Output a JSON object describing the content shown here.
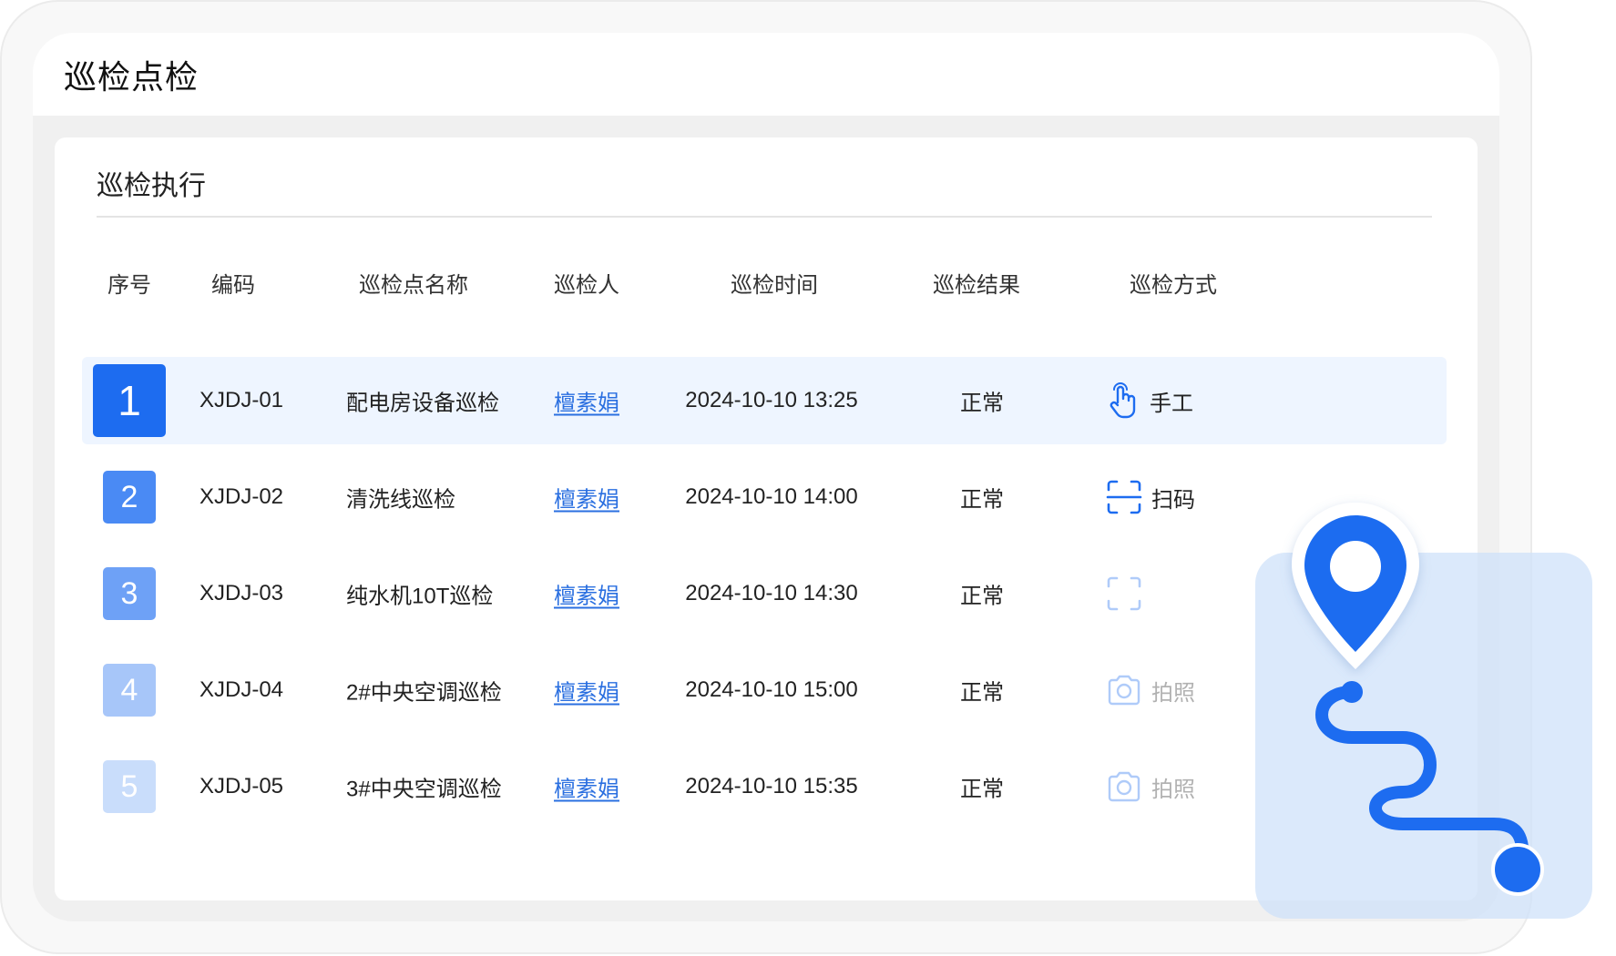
{
  "window": {
    "title": "巡检点检"
  },
  "card": {
    "title": "巡检执行"
  },
  "table": {
    "headers": [
      "序号",
      "编码",
      "巡检点名称",
      "巡检人",
      "巡检时间",
      "巡检结果",
      "巡检方式"
    ],
    "rows": [
      {
        "index": "1",
        "code": "XJDJ-01",
        "name": "配电房设备巡检",
        "inspector": "檀素娟",
        "time": "2024-10-10 13:25",
        "result": "正常",
        "method": "手工",
        "method_icon": "hand-pointer-icon"
      },
      {
        "index": "2",
        "code": "XJDJ-02",
        "name": "清洗线巡检",
        "inspector": "檀素娟",
        "time": "2024-10-10 14:00",
        "result": "正常",
        "method": "扫码",
        "method_icon": "scan-icon"
      },
      {
        "index": "3",
        "code": "XJDJ-03",
        "name": "纯水机10T巡检",
        "inspector": "檀素娟",
        "time": "2024-10-10 14:30",
        "result": "正常",
        "method": "",
        "method_icon": "scan-icon"
      },
      {
        "index": "4",
        "code": "XJDJ-04",
        "name": "2#中央空调巡检",
        "inspector": "檀素娟",
        "time": "2024-10-10 15:00",
        "result": "正常",
        "method": "拍照",
        "method_icon": "camera-icon"
      },
      {
        "index": "5",
        "code": "XJDJ-05",
        "name": "3#中央空调巡检",
        "inspector": "檀素娟",
        "time": "2024-10-10 15:35",
        "result": "正常",
        "method": "拍照",
        "method_icon": "camera-icon"
      }
    ]
  },
  "colors": {
    "accent": "#1d6cf0",
    "link": "#2a6fe0",
    "active_row": "#eef5ff",
    "index_badges": [
      "#1d6cf0",
      "#4a8af4",
      "#6ea1f6",
      "#a7c6f9",
      "#c9ddfb"
    ]
  },
  "decoration": {
    "icons": [
      "location-pin-icon",
      "route-path-icon"
    ]
  }
}
